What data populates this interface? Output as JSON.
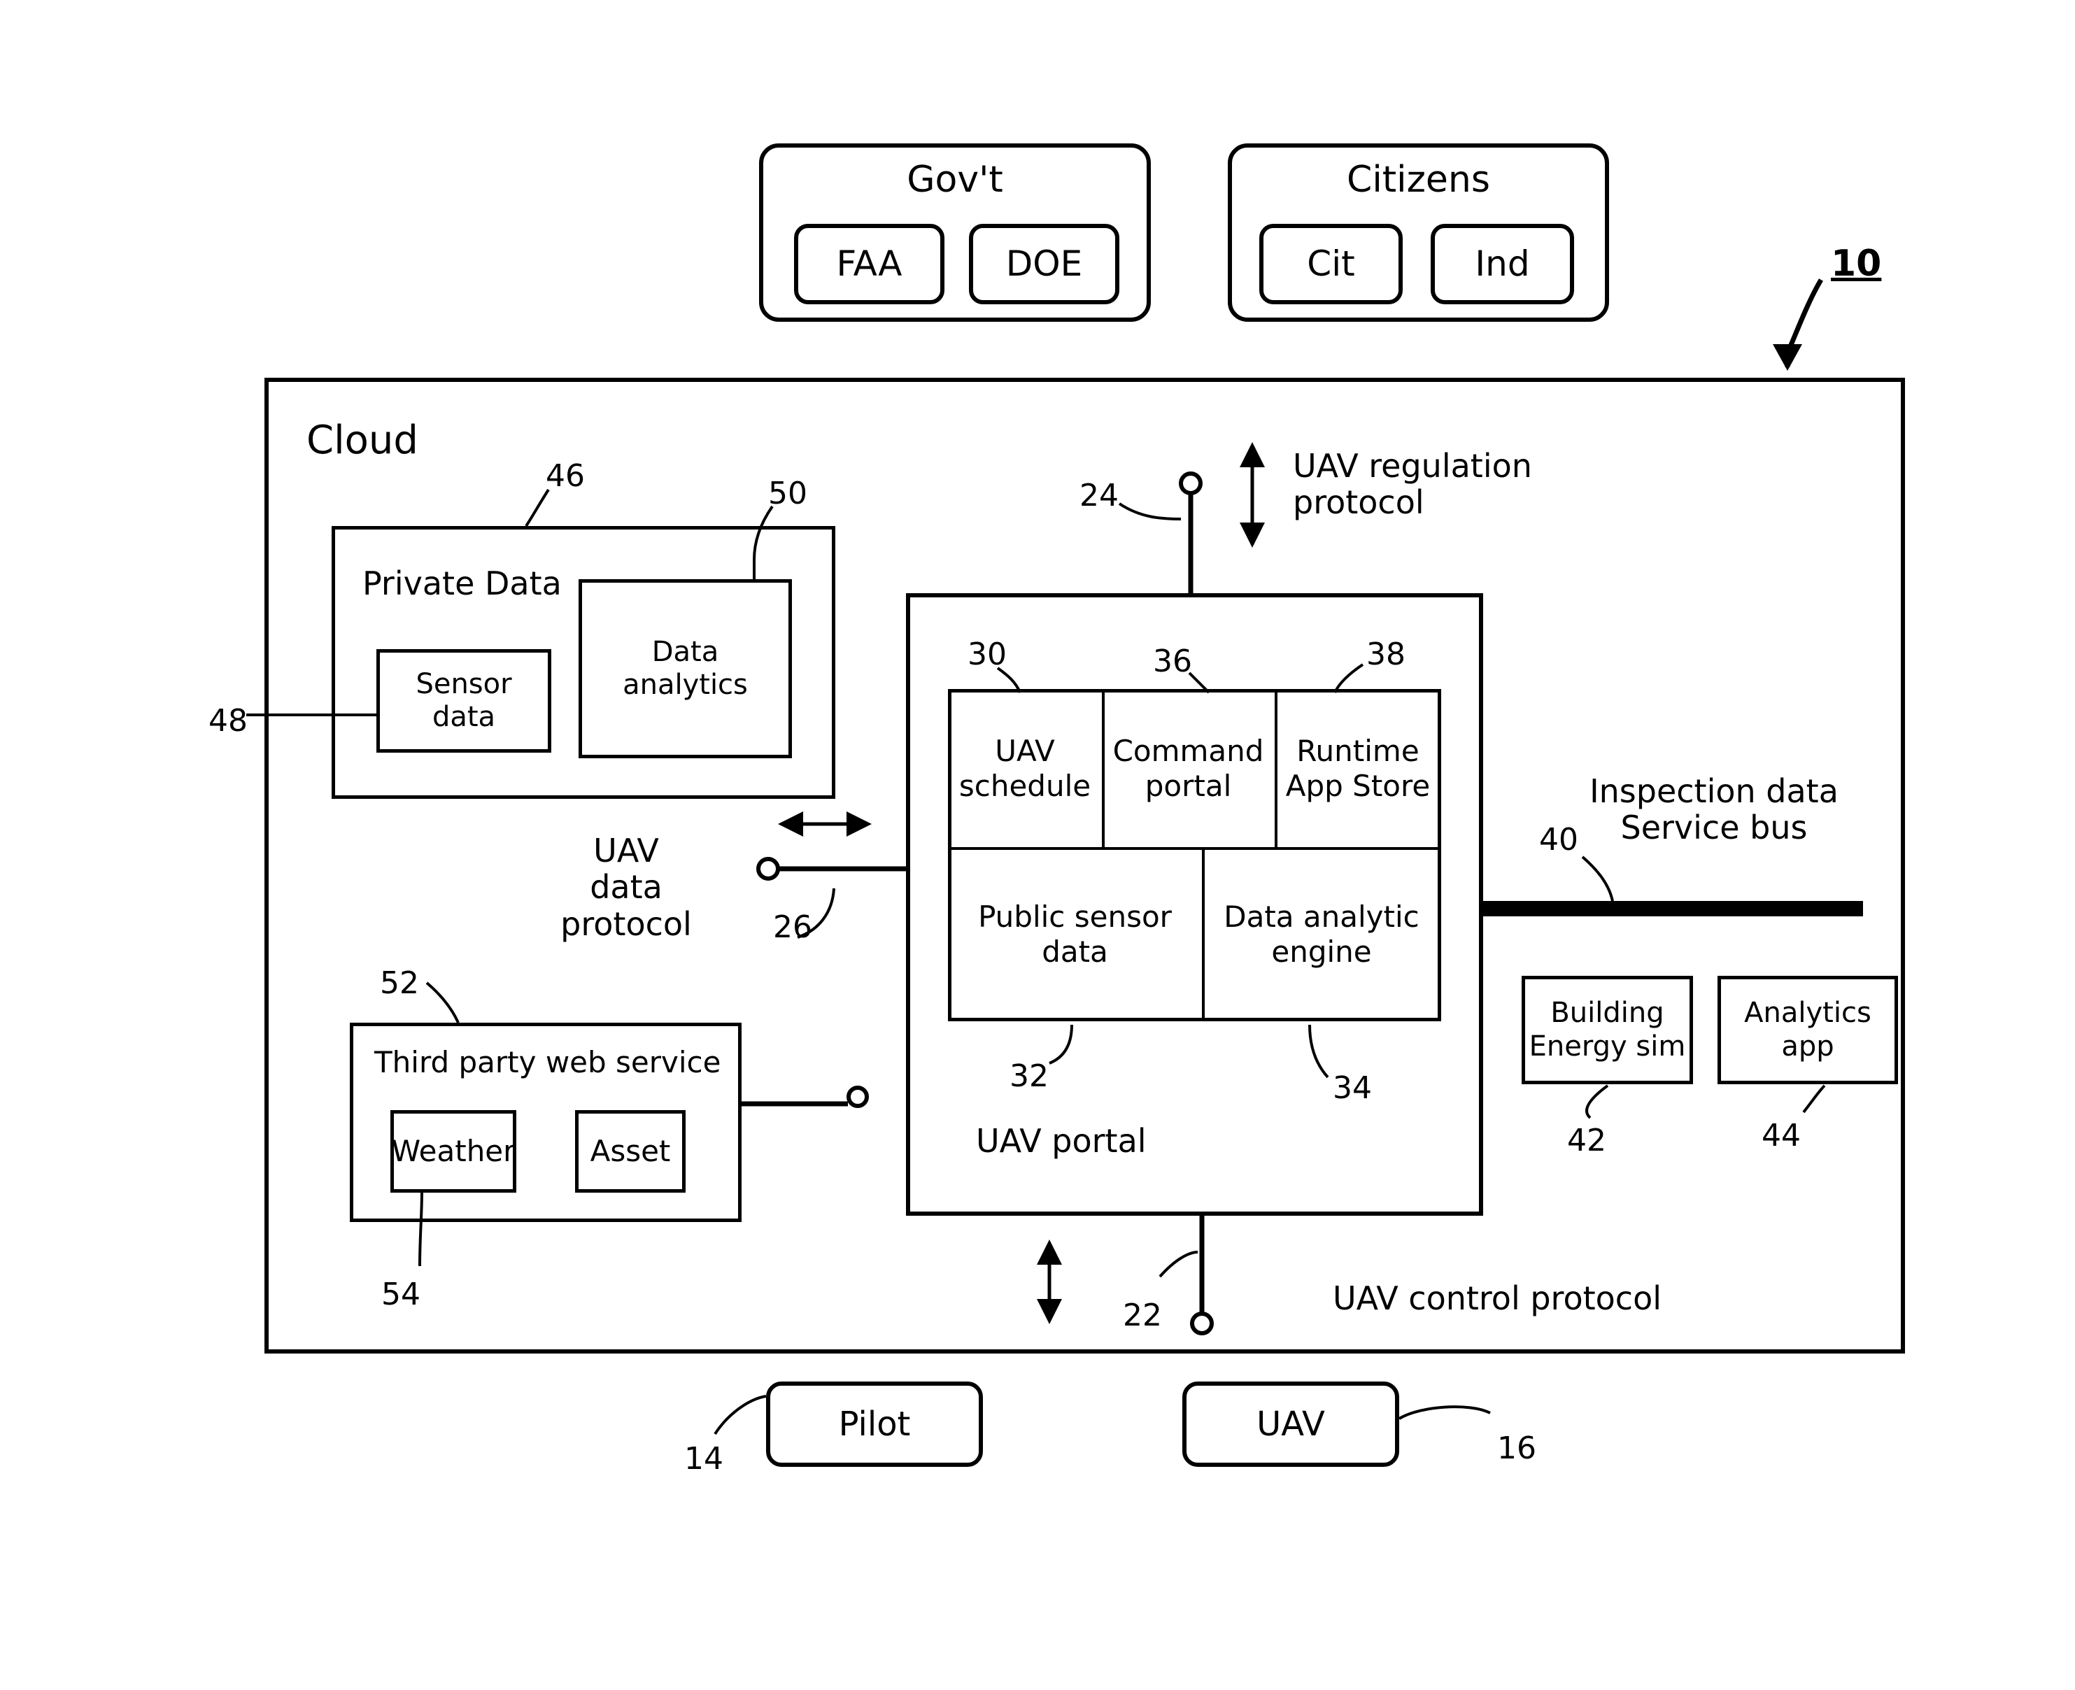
{
  "figure": {
    "reference": "10"
  },
  "top_actors": [
    {
      "title": "Gov't",
      "children": [
        "FAA",
        "DOE"
      ]
    },
    {
      "title": "Citizens",
      "children": [
        "Cit",
        "Ind"
      ]
    }
  ],
  "cloud": {
    "label": "Cloud"
  },
  "private_data": {
    "title": "Private Data",
    "ref_container": "46",
    "ref_sensor": "48",
    "ref_analytics": "50",
    "sensor_data": "Sensor\ndata",
    "data_analytics": "Data\nanalytics"
  },
  "third_party": {
    "title": "Third party web service",
    "ref_container": "52",
    "ref_weather": "54",
    "items": [
      "Weather",
      "Asset"
    ]
  },
  "uav_portal": {
    "label": "UAV portal",
    "top_row": [
      {
        "label": "UAV\nschedule",
        "ref": "30"
      },
      {
        "label": "Command\nportal",
        "ref": "36"
      },
      {
        "label": "Runtime\nApp Store",
        "ref": "38"
      }
    ],
    "bottom_row": [
      {
        "label": "Public sensor\ndata",
        "ref": "32"
      },
      {
        "label": "Data analytic\nengine",
        "ref": "34"
      }
    ]
  },
  "protocols": {
    "regulation": "UAV regulation\nprotocol",
    "regulation_ref": "24",
    "data": "UAV\ndata\nprotocol",
    "data_ref": "26",
    "control": "UAV control protocol",
    "control_ref": "22"
  },
  "service_bus": {
    "title": "Inspection data\nService bus",
    "ref": "40",
    "apps": [
      {
        "label": "Building\nEnergy sim",
        "ref": "42"
      },
      {
        "label": "Analytics\napp",
        "ref": "44"
      }
    ]
  },
  "bottom_actors": [
    {
      "label": "Pilot",
      "ref": "14"
    },
    {
      "label": "UAV",
      "ref": "16"
    }
  ]
}
